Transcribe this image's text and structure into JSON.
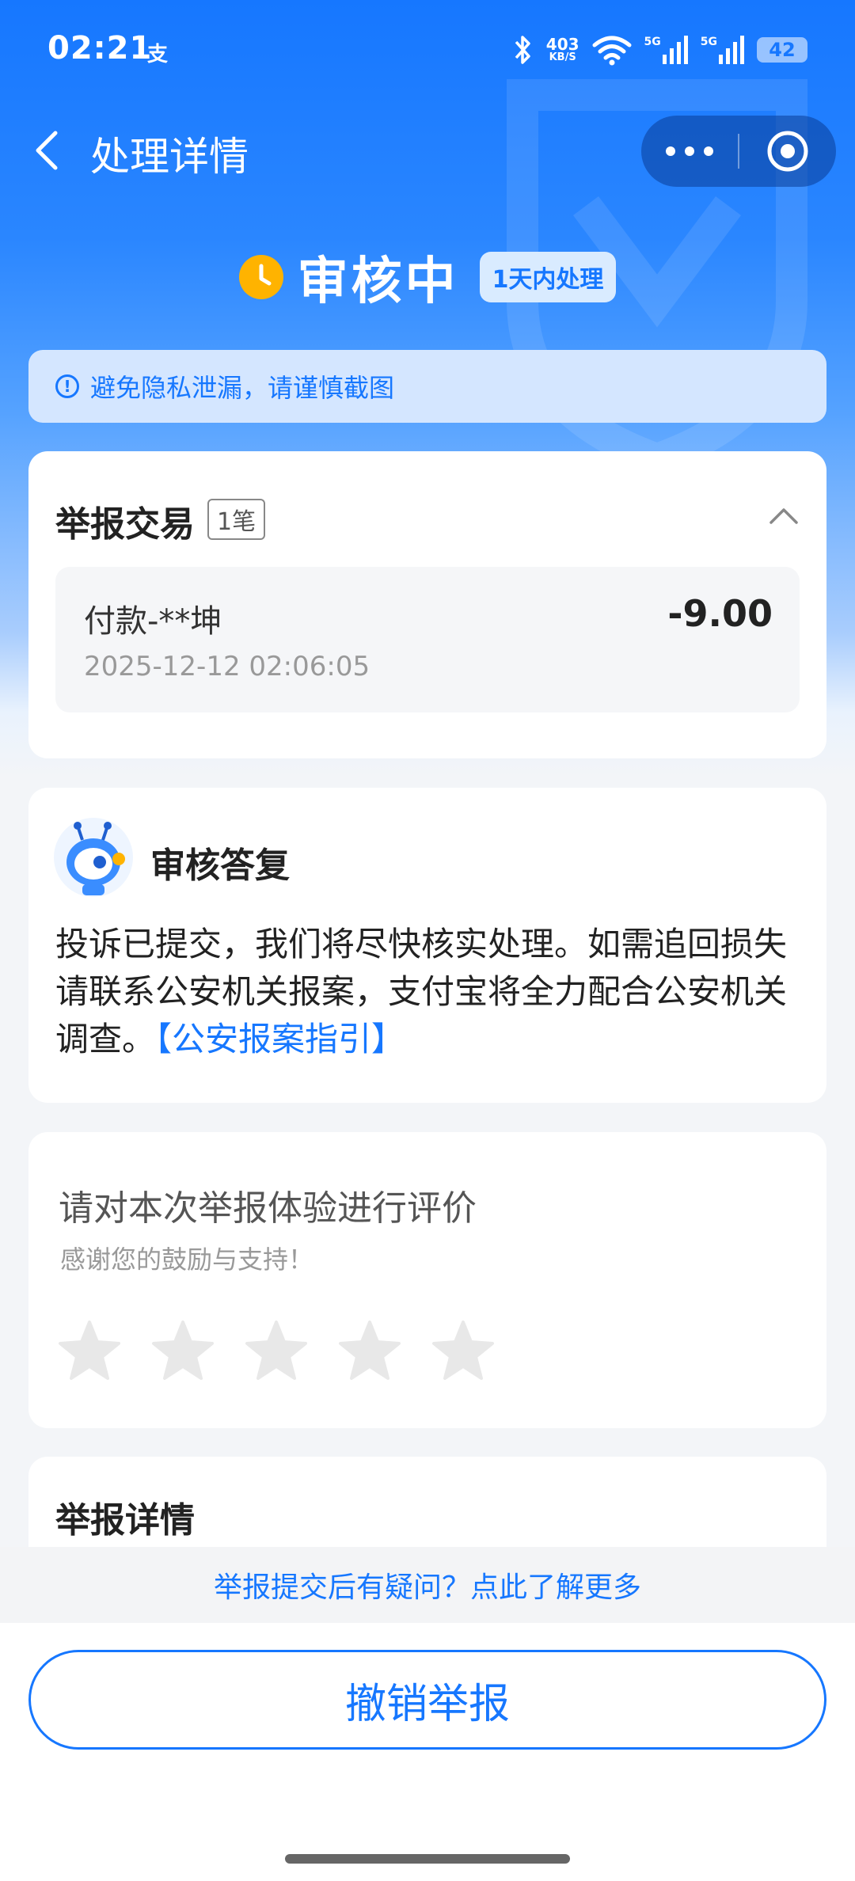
{
  "status_bar": {
    "time": "02:21",
    "app_icon_text": "支",
    "net_speed_value": "403",
    "net_speed_unit": "KB/S",
    "network_1": "5G",
    "network_2": "5G",
    "battery": "42"
  },
  "nav": {
    "title": "处理详情"
  },
  "status": {
    "label": "审核中",
    "badge": "1天内处理"
  },
  "notice": {
    "text": "避免隐私泄漏，请谨慎截图"
  },
  "report_transactions": {
    "title": "举报交易",
    "count": "1笔",
    "items": [
      {
        "name": "付款-**坤",
        "time": "2025-12-12 02:06:05",
        "amount": "-9.00"
      }
    ]
  },
  "review_reply": {
    "title": "审核答复",
    "body": "投诉已提交，我们将尽快核实处理。如需追回损失请联系公安机关报案，支付宝将全力配合公安机关调查。",
    "link": "【公安报案指引】"
  },
  "rating": {
    "title": "请对本次举报体验进行评价",
    "subtitle": "感谢您的鼓励与支持！",
    "stars_total": 5,
    "stars_selected": 0
  },
  "report_details": {
    "title": "举报详情"
  },
  "footer": {
    "faq_link": "举报提交后有疑问？点此了解更多",
    "cancel_button": "撤销举报"
  },
  "colors": {
    "accent": "#1677ff",
    "status_icon": "#ffb300"
  }
}
